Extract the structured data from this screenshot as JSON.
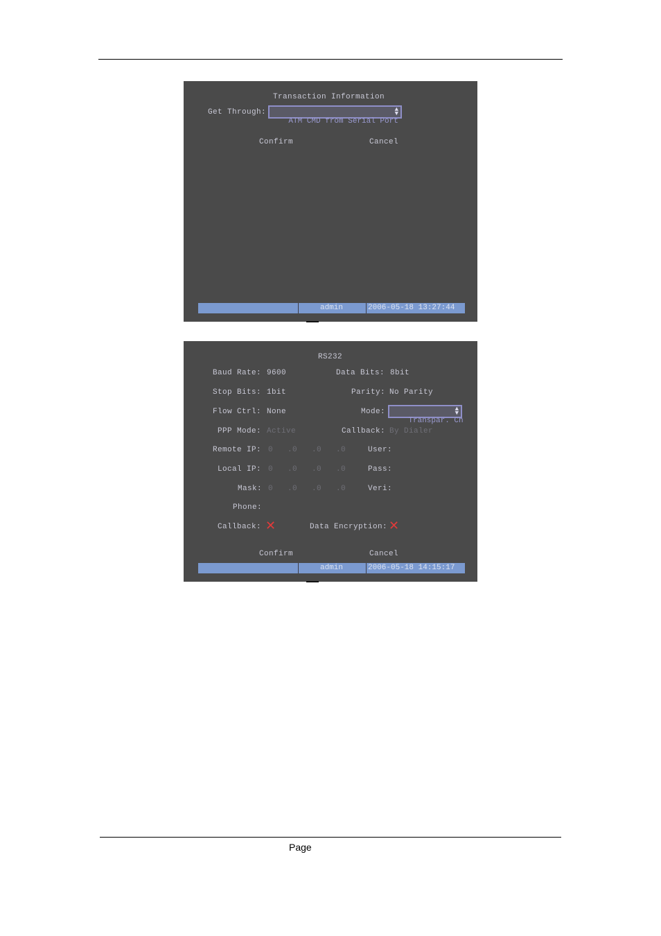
{
  "page": {
    "footer_label": "Page"
  },
  "transaction_screen": {
    "title": "Transaction Information",
    "get_through_label": "Get Through:",
    "get_through_value": "ATM CMD from Serial Port",
    "confirm": "Confirm",
    "cancel": "Cancel",
    "status": {
      "user": "admin",
      "datetime": "2006-05-18 13:27:44"
    }
  },
  "rs232_screen": {
    "title": "RS232",
    "baud_rate": {
      "label": "Baud Rate:",
      "value": "9600"
    },
    "data_bits": {
      "label": "Data Bits:",
      "value": "8bit"
    },
    "stop_bits": {
      "label": "Stop Bits:",
      "value": "1bit"
    },
    "parity": {
      "label": "Parity:",
      "value": "No Parity"
    },
    "flow_ctrl": {
      "label": "Flow Ctrl:",
      "value": "None"
    },
    "mode": {
      "label": "Mode:",
      "value": "Transpar. Ch"
    },
    "ppp_mode": {
      "label": "PPP Mode:",
      "value": "Active"
    },
    "callback_mode": {
      "label": "Callback:",
      "value": "By Dialer"
    },
    "remote_ip": {
      "label": "Remote IP:",
      "value": "0   .0   .0   .0"
    },
    "local_ip": {
      "label": "Local IP:",
      "value": "0   .0   .0   .0"
    },
    "mask": {
      "label": "Mask:",
      "value": "0   .0   .0   .0"
    },
    "user": {
      "label": "User:"
    },
    "pass": {
      "label": "Pass:"
    },
    "veri": {
      "label": "Veri:"
    },
    "phone": {
      "label": "Phone:"
    },
    "callback_check": {
      "label": "Callback:",
      "checked": false,
      "icon": "red-x-icon"
    },
    "data_encryption": {
      "label": "Data Encryption:",
      "checked": false,
      "icon": "red-x-icon"
    },
    "confirm": "Confirm",
    "cancel": "Cancel",
    "status": {
      "user": "admin",
      "datetime": "2006-05-18 14:15:17"
    }
  },
  "colors": {
    "screen_bg": "#4a4a4a",
    "status_bar": "#7b9ad0",
    "text": "#c9c9d6",
    "disabled": "#6f6f77",
    "x_mark": "#e23a3a"
  }
}
